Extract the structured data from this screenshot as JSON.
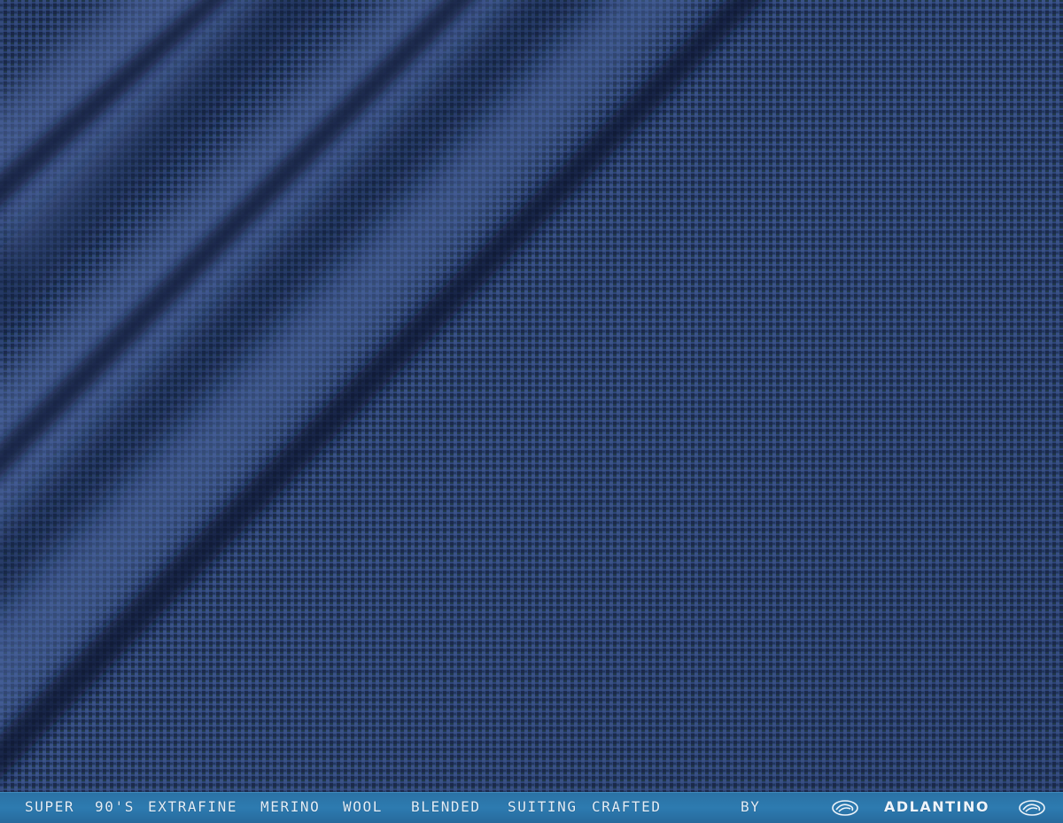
{
  "image": {
    "subject": "navy blue houndstooth check suiting fabric draped in folds",
    "colors": {
      "base": "#2b4070",
      "weave_light": "#3a5184",
      "weave_dark": "#1a2544",
      "weave_green": "#1f3a45",
      "selvedge": "#2d7bb0",
      "selvedge_text": "#e3eef7"
    }
  },
  "selvedge": {
    "words": [
      "SUPER",
      "90'S",
      "EXTRAFINE",
      "MERINO",
      "WOOL",
      "BLENDED",
      "SUITING",
      "CRAFTED",
      "BY"
    ],
    "brand": "ADLANTINO",
    "logo_icon": "woven-swirl-icon"
  }
}
